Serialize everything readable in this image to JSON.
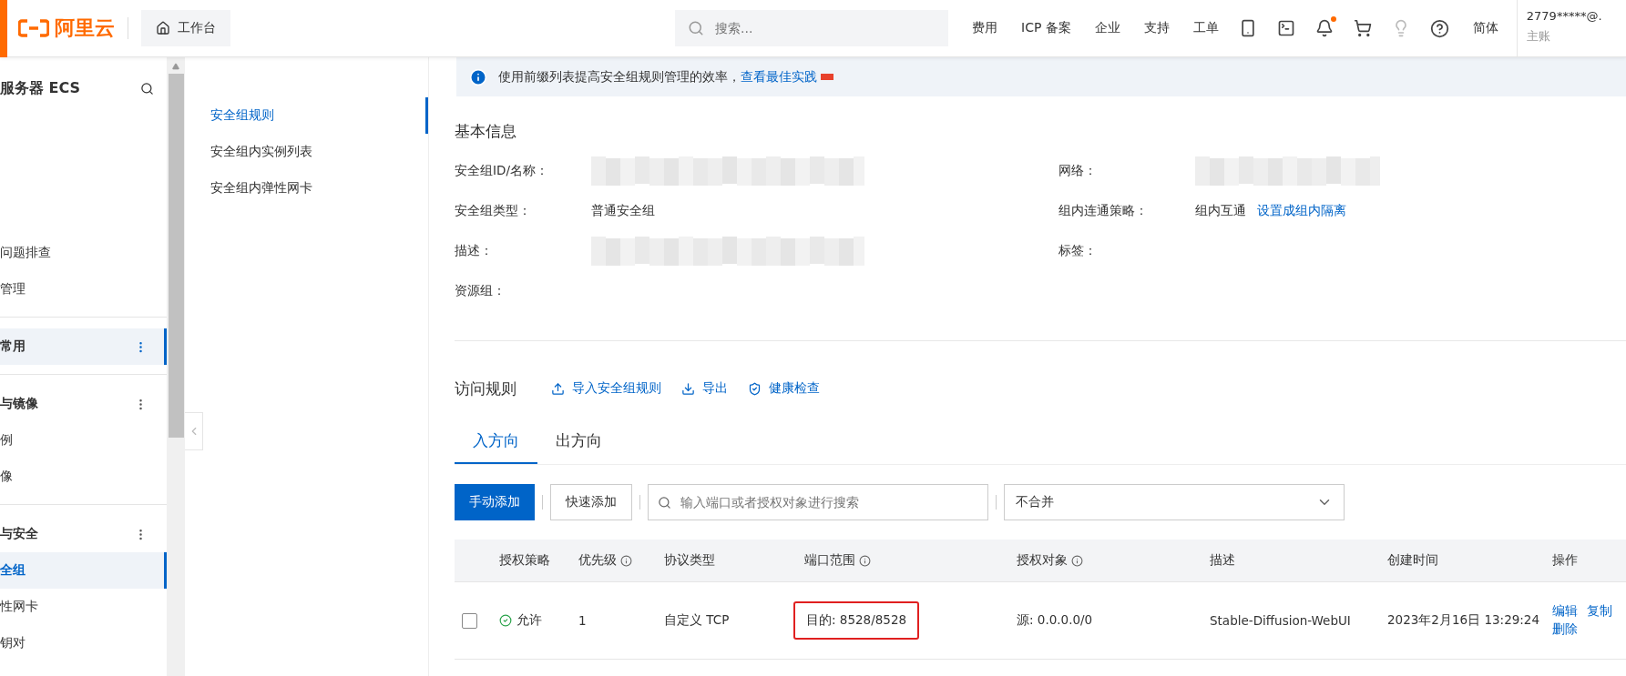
{
  "topbar": {
    "logo": "阿里云",
    "workbench": "工作台",
    "search": {
      "placeholder": "搜索..."
    },
    "links": [
      "费用",
      "ICP 备案",
      "企业",
      "支持",
      "工单"
    ],
    "notification_dot": true,
    "language": "简体",
    "user": {
      "name": "2779*****@.",
      "role": "主账"
    }
  },
  "sidebar": {
    "title": "服务器 ECS",
    "items": [
      {
        "kind": "item",
        "label": "问题排查",
        "selected": false
      },
      {
        "kind": "item",
        "label": "管理",
        "selected": false
      },
      {
        "kind": "group",
        "label": "常用",
        "selected": true
      },
      {
        "kind": "group",
        "label": "与镜像",
        "selected": false
      },
      {
        "kind": "item",
        "label": "例",
        "selected": false
      },
      {
        "kind": "item",
        "label": "像",
        "selected": false
      },
      {
        "kind": "group",
        "label": "与安全",
        "selected": false
      },
      {
        "kind": "item",
        "label": "全组",
        "selected": true
      },
      {
        "kind": "item",
        "label": "性网卡",
        "selected": false
      },
      {
        "kind": "item",
        "label": "钥对",
        "selected": false
      }
    ]
  },
  "banner": {
    "text": "使用前缀列表提高安全组规则管理的效率，",
    "link": "查看最佳实践",
    "badge_new": true
  },
  "subnav": [
    {
      "label": "安全组规则",
      "selected": true
    },
    {
      "label": "安全组内实例列表",
      "selected": false
    },
    {
      "label": "安全组内弹性网卡",
      "selected": false
    }
  ],
  "basic_info": {
    "title": "基本信息",
    "left": [
      {
        "label": "安全组ID/名称：",
        "kind": "redacted"
      },
      {
        "label": "安全组类型：",
        "kind": "text",
        "value": "普通安全组"
      },
      {
        "label": "描述：",
        "kind": "redacted"
      },
      {
        "label": "资源组：",
        "kind": "empty"
      }
    ],
    "right": [
      {
        "label": "网络：",
        "kind": "redacted"
      },
      {
        "label": "组内连通策略：",
        "kind": "text",
        "value": "组内互通",
        "link": "设置成组内隔离"
      },
      {
        "label": "标签：",
        "kind": "empty"
      }
    ]
  },
  "rules": {
    "title": "访问规则",
    "actions": [
      {
        "kind": "upload",
        "label": "导入安全组规则"
      },
      {
        "kind": "download",
        "label": "导出"
      },
      {
        "kind": "shield",
        "label": "健康检查"
      }
    ],
    "tabs": [
      {
        "label": "入方向",
        "selected": true
      },
      {
        "label": "出方向",
        "selected": false
      }
    ],
    "add_button": "手动添加",
    "quick_add_button": "快速添加",
    "search": {
      "placeholder": "输入端口或者授权对象进行搜索"
    },
    "merge_select": "不合并",
    "columns": [
      {
        "label": "授权策略",
        "info": false
      },
      {
        "label": "优先级",
        "info": true
      },
      {
        "label": "协议类型",
        "info": false
      },
      {
        "label": "端口范围",
        "info": true
      },
      {
        "label": "授权对象",
        "info": true
      },
      {
        "label": "描述",
        "info": false
      },
      {
        "label": "创建时间",
        "info": false
      },
      {
        "label": "操作",
        "info": false
      }
    ],
    "rows": [
      {
        "checked": false,
        "policy": "允许",
        "priority": "1",
        "protocol": "自定义 TCP",
        "port": "目的: 8528/8528",
        "port_highlighted": true,
        "source": "源: 0.0.0.0/0",
        "description": "Stable-Diffusion-WebUI",
        "created": "2023年2月16日 13:29:24",
        "actions": [
          "编辑",
          "复制",
          "删除"
        ]
      }
    ]
  }
}
